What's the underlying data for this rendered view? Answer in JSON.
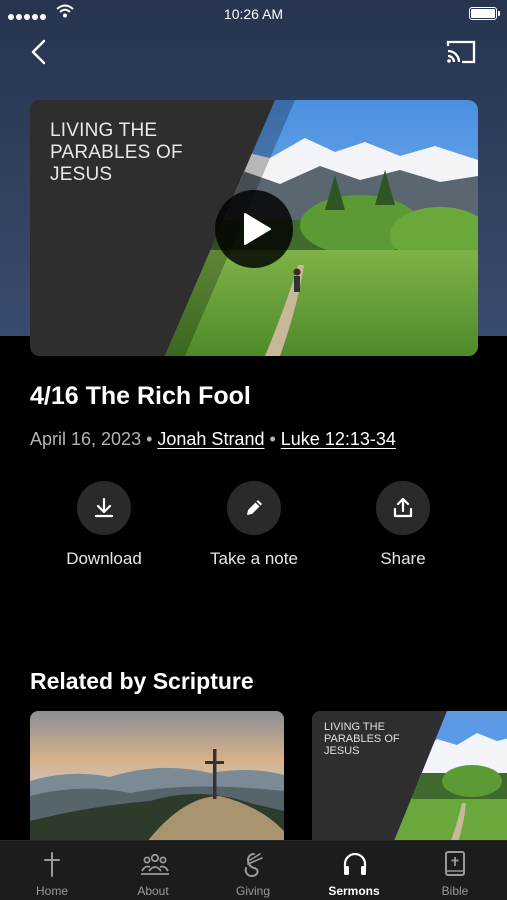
{
  "status_bar": {
    "time": "10:26 AM"
  },
  "video": {
    "series_title": "LIVING THE PARABLES OF JESUS"
  },
  "sermon": {
    "title": "4/16 The Rich Fool",
    "date": "April 16, 2023",
    "separator": "•",
    "speaker": "Jonah Strand",
    "scripture": "Luke 12:13-34"
  },
  "actions": [
    {
      "label": "Download",
      "icon": "download-icon"
    },
    {
      "label": "Take a note",
      "icon": "pencil-icon"
    },
    {
      "label": "Share",
      "icon": "share-icon"
    }
  ],
  "related": {
    "heading": "Related by Scripture",
    "cards": [
      {
        "image": "mountain-cross-image"
      },
      {
        "series_title": "LIVING THE PARABLES OF JESUS"
      }
    ]
  },
  "tabs": [
    {
      "label": "Home",
      "icon": "cross-icon",
      "active": false
    },
    {
      "label": "About",
      "icon": "people-icon",
      "active": false
    },
    {
      "label": "Giving",
      "icon": "giving-icon",
      "active": false
    },
    {
      "label": "Sermons",
      "icon": "headphones-icon",
      "active": true
    },
    {
      "label": "Bible",
      "icon": "bible-icon",
      "active": false
    }
  ],
  "colors": {
    "header_bg": "#3a4c6e",
    "background": "#000000",
    "tab_bar": "#1c1c1c"
  }
}
